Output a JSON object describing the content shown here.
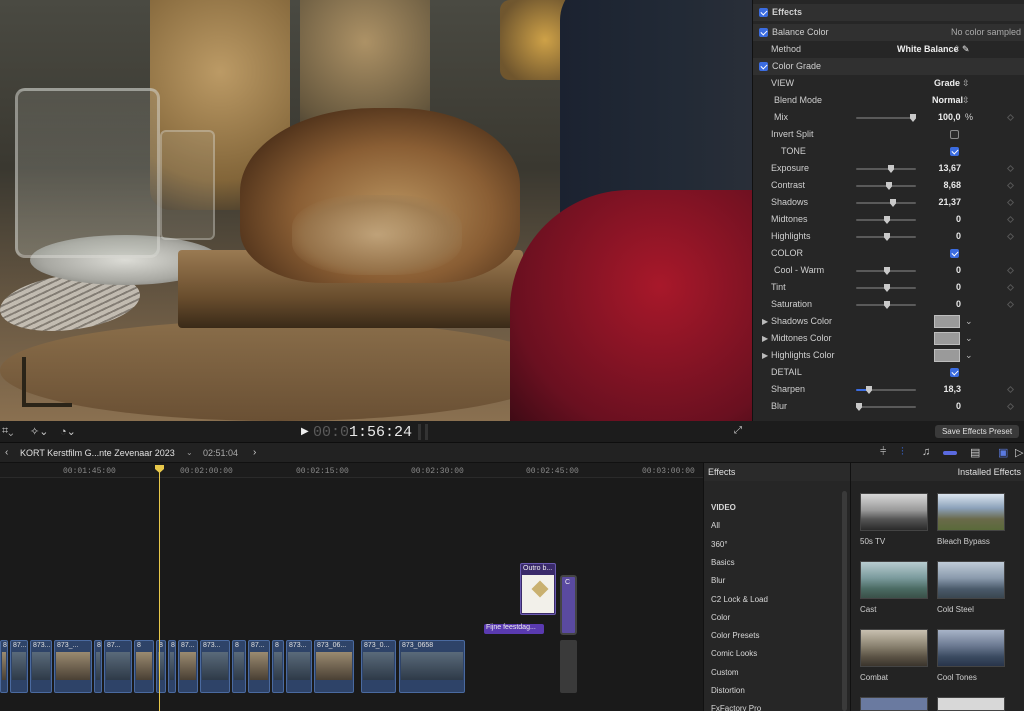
{
  "viewer": {
    "timecode_dim": "00:0",
    "timecode": "1:56:24",
    "save_effects_preset": "Save Effects Preset"
  },
  "inspector": {
    "effects": "Effects",
    "balance_color": "Balance Color",
    "no_color_sampled": "No color sampled",
    "method_label": "Method",
    "method_value": "White Balance",
    "color_grade": "Color Grade",
    "view_label": "VIEW",
    "view_value": "Grade",
    "blend_mode_label": "Blend Mode",
    "blend_mode_value": "Normal",
    "mix_label": "Mix",
    "mix_value": "100,0",
    "mix_unit": "%",
    "invert_split": "Invert Split",
    "tone": "TONE",
    "exposure": {
      "label": "Exposure",
      "value": "13,67",
      "level": 0.57
    },
    "contrast": {
      "label": "Contrast",
      "value": "8,68",
      "level": 0.54
    },
    "shadows": {
      "label": "Shadows",
      "value": "21,37",
      "level": 0.6
    },
    "midtones": {
      "label": "Midtones",
      "value": "0",
      "level": 0.5
    },
    "highlights": {
      "label": "Highlights",
      "value": "0",
      "level": 0.5
    },
    "color": "COLOR",
    "cool_warm": {
      "label": "Cool - Warm",
      "value": "0",
      "level": 0.5
    },
    "tint": {
      "label": "Tint",
      "value": "0",
      "level": 0.5
    },
    "saturation": {
      "label": "Saturation",
      "value": "0",
      "level": 0.5
    },
    "shadows_color": "Shadows Color",
    "midtones_color": "Midtones Color",
    "highlights_color": "Highlights Color",
    "detail": "DETAIL",
    "sharpen": {
      "label": "Sharpen",
      "value": "18,3",
      "level": 0.18
    },
    "blur": {
      "label": "Blur",
      "value": "0",
      "level": 0.0
    }
  },
  "timeline": {
    "project": "KORT Kerstfilm G...nte Zevenaar 2023",
    "duration": "02:51:04",
    "ruler": [
      "00:01:45:00",
      "00:02:00:00",
      "00:02:15:00",
      "00:02:30:00",
      "00:02:45:00",
      "00:03:00:00"
    ],
    "clips": [
      "8",
      "87...",
      "873...",
      "873_...",
      "8",
      "87...",
      "8",
      "8",
      "8",
      "87...",
      "873...",
      "8",
      "87...",
      "8",
      "873...",
      "873_06...",
      "873_0...",
      "873_0658"
    ],
    "title_clip": "Outro b...",
    "title_clip2": "C",
    "fijne": "Fijne feestdag..."
  },
  "browser": {
    "effects": "Effects",
    "installed": "Installed Effects",
    "categories": [
      "VIDEO",
      "All",
      "360°",
      "Basics",
      "Blur",
      "C2 Lock & Load",
      "Color",
      "Color Presets",
      "Comic Looks",
      "Custom",
      "Distortion",
      "FxFactory Pro"
    ],
    "presets": [
      "50s TV",
      "Bleach Bypass",
      "Cast",
      "Cold Steel",
      "Combat",
      "Cool Tones"
    ]
  }
}
